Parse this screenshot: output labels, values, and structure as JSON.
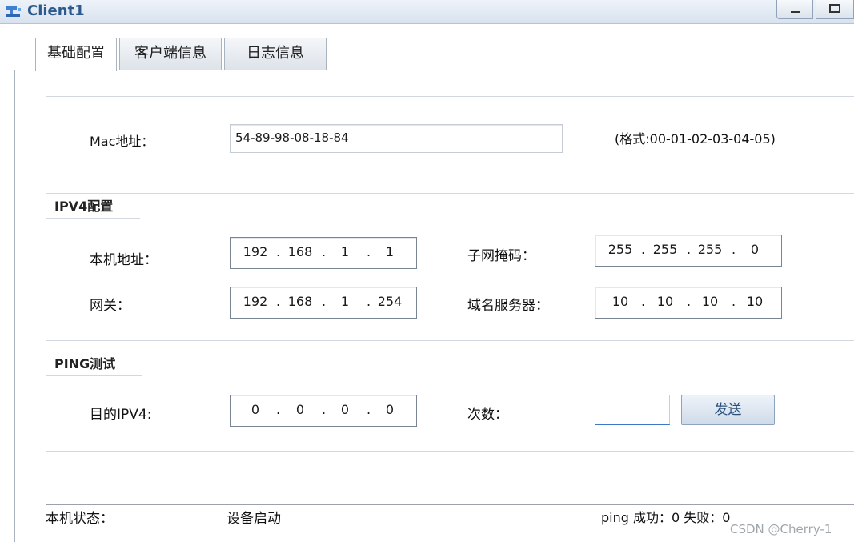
{
  "window": {
    "title": "Client1"
  },
  "tabs": [
    {
      "label": "基础配置",
      "active": true
    },
    {
      "label": "客户端信息",
      "active": false
    },
    {
      "label": "日志信息",
      "active": false
    }
  ],
  "mac": {
    "label": "Mac地址：",
    "value": "54-89-98-08-18-84",
    "hint": "(格式:00-01-02-03-04-05)"
  },
  "ipv4": {
    "legend": "IPV4配置",
    "host_label": "本机地址：",
    "host_ip": [
      "192",
      "168",
      "1",
      "1"
    ],
    "mask_label": "子网掩码：",
    "mask": [
      "255",
      "255",
      "255",
      "0"
    ],
    "gateway_label": "网关：",
    "gateway": [
      "192",
      "168",
      "1",
      "254"
    ],
    "dns_label": "域名服务器：",
    "dns": [
      "10",
      "10",
      "10",
      "10"
    ]
  },
  "ping": {
    "legend": "PING测试",
    "dest_label": "目的IPV4:",
    "dest": [
      "0",
      "0",
      "0",
      "0"
    ],
    "count_label": "次数：",
    "count_value": "",
    "send_label": "发送"
  },
  "status": {
    "label": "本机状态：",
    "value": "设备启动",
    "ping_result": "ping 成功：0 失败：0"
  },
  "watermark": "CSDN @Cherry-1",
  "colors": {
    "accent": "#3c78c8",
    "title": "#2c5a8e"
  }
}
